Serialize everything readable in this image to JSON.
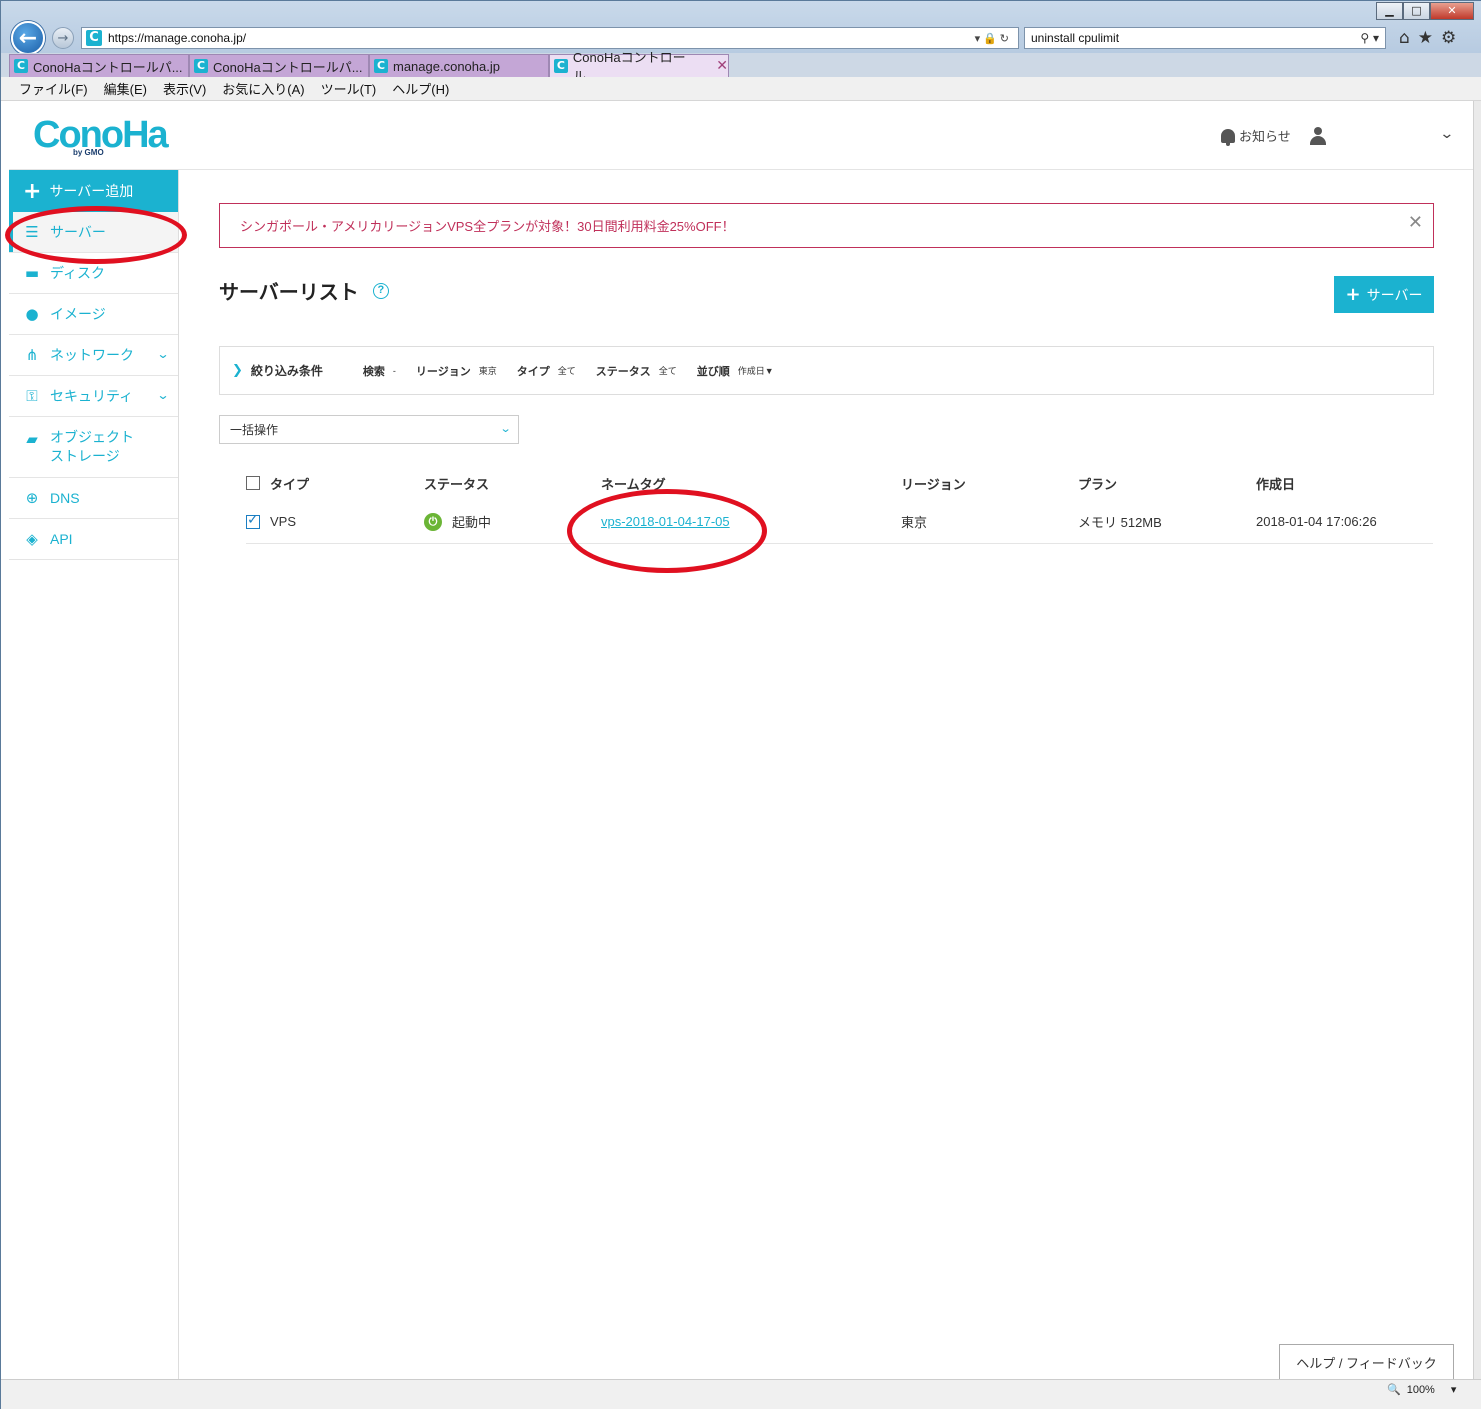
{
  "browser": {
    "url": "https://manage.conoha.jp/",
    "search_value": "uninstall cpulimit",
    "tabs": [
      {
        "label": "ConoHaコントロールパ..."
      },
      {
        "label": "ConoHaコントロールパ..."
      },
      {
        "label": "manage.conoha.jp"
      },
      {
        "label": "ConoHaコントロール..."
      }
    ],
    "menu": [
      "ファイル(F)",
      "編集(E)",
      "表示(V)",
      "お気に入り(A)",
      "ツール(T)",
      "ヘルプ(H)"
    ],
    "zoom": "100%"
  },
  "header": {
    "logo": "ConoHa",
    "logo_sub": "by GMO",
    "notice_label": "お知らせ"
  },
  "sidebar": {
    "add_label": "サーバー追加",
    "items": [
      {
        "label": "サーバー",
        "icon": "server-icon"
      },
      {
        "label": "ディスク",
        "icon": "disk-icon"
      },
      {
        "label": "イメージ",
        "icon": "globe-icon"
      },
      {
        "label": "ネットワーク",
        "icon": "network-icon"
      },
      {
        "label": "セキュリティ",
        "icon": "key-icon"
      },
      {
        "label1": "オブジェクト",
        "label2": "ストレージ",
        "icon": "folder-icon"
      },
      {
        "label": "DNS",
        "icon": "dns-globe-icon"
      },
      {
        "label": "API",
        "icon": "api-icon"
      }
    ]
  },
  "main": {
    "banner": "シンガポール・アメリカリージョンVPS全プランが対象！30日間利用料金25%OFF！",
    "title": "サーバーリスト",
    "add_server_label": "サーバー",
    "filter": {
      "title": "絞り込み条件",
      "search_k": "検索",
      "search_v": "-",
      "region_k": "リージョン",
      "region_v": "東京",
      "type_k": "タイプ",
      "type_v": "全て",
      "status_k": "ステータス",
      "status_v": "全て",
      "sort_k": "並び順",
      "sort_v": "作成日▼"
    },
    "bulk_label": "一括操作",
    "table": {
      "headers": [
        "タイプ",
        "ステータス",
        "ネームタグ",
        "リージョン",
        "プラン",
        "作成日"
      ],
      "rows": [
        {
          "type": "VPS",
          "status": "起動中",
          "nametag": "vps-2018-01-04-17-05",
          "region": "東京",
          "plan": "メモリ 512MB",
          "created": "2018-01-04 17:06:26",
          "checked": true
        }
      ]
    },
    "feedback_label": "ヘルプ / フィードバック"
  },
  "colors": {
    "accent": "#1bb2d0",
    "banner": "#c0305a",
    "annotation": "#e01020",
    "running": "#6bb536"
  }
}
